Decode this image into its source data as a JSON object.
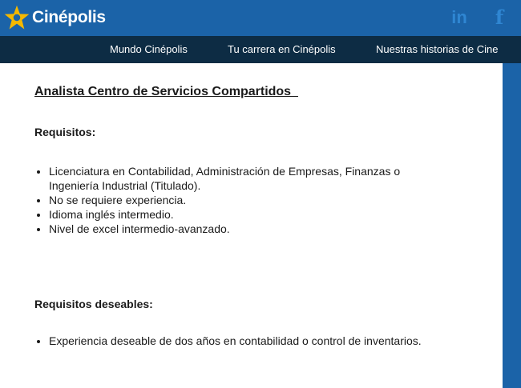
{
  "header": {
    "brand": "Cinépolis",
    "brand_color": "#1b63a8",
    "star_color": "#f4b800",
    "social": [
      {
        "name": "linkedin",
        "glyph": "in"
      },
      {
        "name": "facebook",
        "glyph": "f"
      }
    ]
  },
  "nav": {
    "items": [
      {
        "label": "Mundo Cinépolis"
      },
      {
        "label": "Tu carrera en Cinépolis"
      },
      {
        "label": "Nuestras historias de Cine"
      }
    ]
  },
  "job": {
    "title": "Analista Centro de Servicios Compartidos  ",
    "requirements_heading": "Requisitos:",
    "requirements": [
      "Licenciatura en Contabilidad,  Administración de Empresas, Finanzas o Ingeniería Industrial (Titulado).",
      "No se requiere experiencia.",
      "Idioma inglés intermedio.",
      "Nivel de excel intermedio-avanzado."
    ],
    "desirable_heading": "Requisitos deseables:",
    "desirable": [
      "Experiencia deseable de dos años en contabilidad o control de inventarios."
    ]
  }
}
